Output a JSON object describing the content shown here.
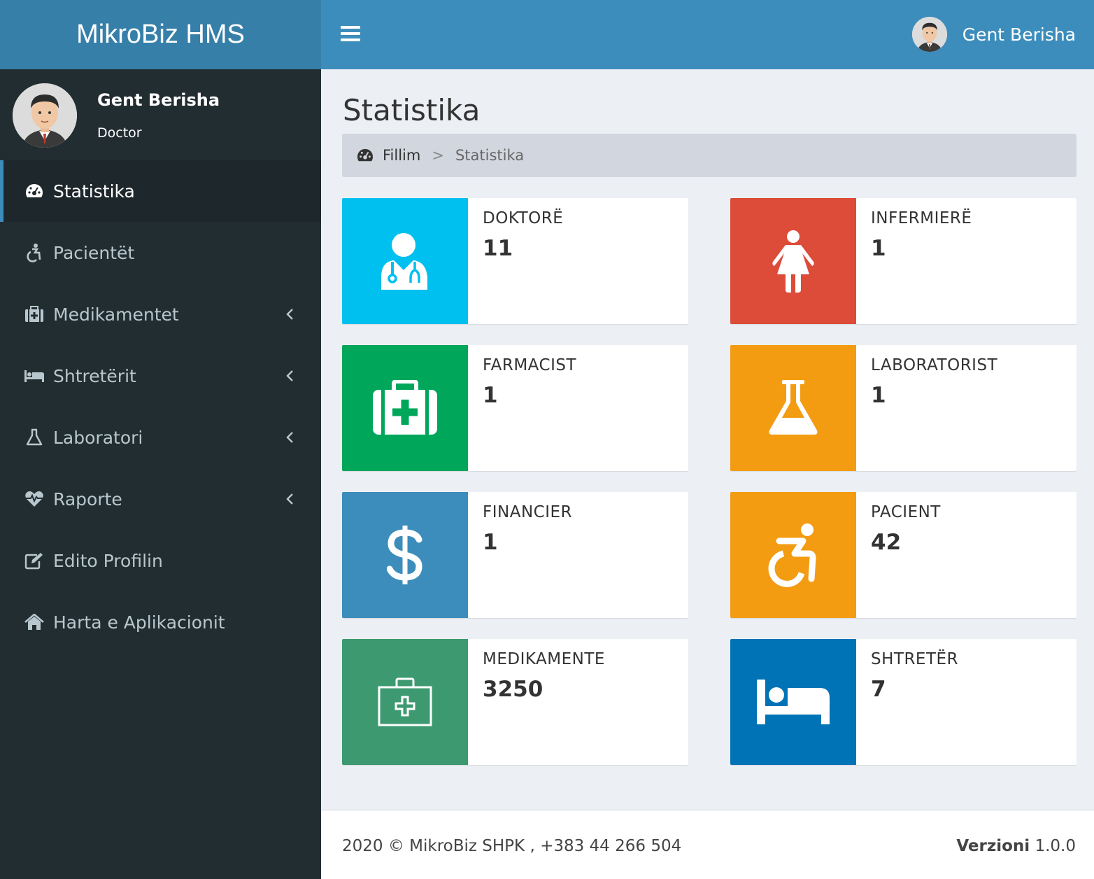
{
  "brand": "MikroBiz HMS",
  "user": {
    "name": "Gent Berisha",
    "role": "Doctor"
  },
  "sidebar": {
    "items": [
      {
        "label": "Statistika",
        "icon": "dashboard-icon",
        "active": true,
        "submenu": false
      },
      {
        "label": "Pacientët",
        "icon": "wheelchair-icon",
        "active": false,
        "submenu": false
      },
      {
        "label": "Medikamentet",
        "icon": "medkit-icon",
        "active": false,
        "submenu": true
      },
      {
        "label": "Shtretërit",
        "icon": "bed-icon",
        "active": false,
        "submenu": true
      },
      {
        "label": "Laboratori",
        "icon": "flask-icon",
        "active": false,
        "submenu": true
      },
      {
        "label": "Raporte",
        "icon": "heartbeat-icon",
        "active": false,
        "submenu": true
      },
      {
        "label": "Edito Profilin",
        "icon": "edit-icon",
        "active": false,
        "submenu": false
      },
      {
        "label": "Harta e Aplikacionit",
        "icon": "home-icon",
        "active": false,
        "submenu": false
      }
    ]
  },
  "header": {
    "user_name": "Gent Berisha"
  },
  "page": {
    "title": "Statistika",
    "breadcrumb": {
      "home": "Fillim",
      "separator": ">",
      "current": "Statistika"
    }
  },
  "stats": [
    {
      "label": "DOKTORË",
      "value": "11",
      "color": "#00c0ef",
      "icon": "user-doctor-icon"
    },
    {
      "label": "INFERMIERË",
      "value": "1",
      "color": "#dd4b39",
      "icon": "female-icon"
    },
    {
      "label": "FARMACIST",
      "value": "1",
      "color": "#00a65a",
      "icon": "medkit-icon"
    },
    {
      "label": "LABORATORIST",
      "value": "1",
      "color": "#f39c12",
      "icon": "flask-icon"
    },
    {
      "label": "FINANCIER",
      "value": "1",
      "color": "#3c8dbc",
      "icon": "dollar-icon"
    },
    {
      "label": "PACIENT",
      "value": "42",
      "color": "#f39c12",
      "icon": "wheelchair-icon"
    },
    {
      "label": "MEDIKAMENTE",
      "value": "3250",
      "color": "#3d9970",
      "icon": "medical-case-icon"
    },
    {
      "label": "SHTRETËR",
      "value": "7",
      "color": "#0073b7",
      "icon": "bed-icon"
    }
  ],
  "footer": {
    "copyright": "2020 © MikroBiz SHPK , +383 44 266 504",
    "version_label": "Verzioni",
    "version": "1.0.0"
  }
}
